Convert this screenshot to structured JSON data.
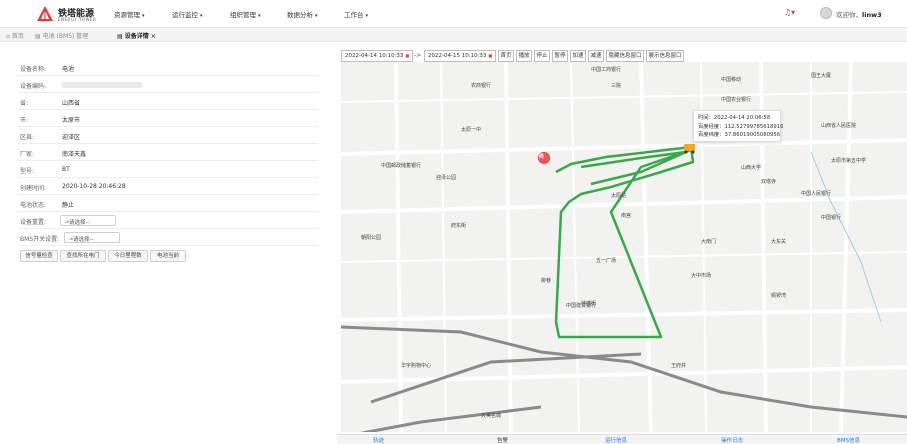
{
  "header": {
    "brand": "铁塔能源",
    "brand_sub": "ENERGY TOWER",
    "nav": [
      "资源管理",
      "运行监控",
      "组织管理",
      "数据分析",
      "工作台"
    ],
    "welcome": "欢迎你，",
    "username": "linw3"
  },
  "tabs": [
    {
      "label": "首页"
    },
    {
      "label": "电池 (BMS) 管理"
    },
    {
      "label": "设备详情"
    }
  ],
  "device": {
    "fields": [
      {
        "label": "设备名称:",
        "value": "电池"
      },
      {
        "label": "设备编码:",
        "value": ""
      },
      {
        "label": "省:",
        "value": "山西省"
      },
      {
        "label": "市:",
        "value": "太原市"
      },
      {
        "label": "区县:",
        "value": "迎泽区"
      },
      {
        "label": "厂家:",
        "value": "南泽天鑫"
      },
      {
        "label": "型号:",
        "value": "BT"
      },
      {
        "label": "创建时间:",
        "value": "2020-10-28 20:46:28"
      },
      {
        "label": "电池状态:",
        "value": "静止"
      }
    ],
    "selects": [
      {
        "label": "设备重置:",
        "value": "--请选择--"
      },
      {
        "label": "BMS开关设置:",
        "value": "--请选择--"
      }
    ],
    "buttons": [
      "信号量检查",
      "查找所在电门",
      "今日里程数",
      "电池当前"
    ]
  },
  "map_controls": {
    "start": "2022-04-14 10:10:33",
    "end": "2022-04-15 10:10:33",
    "arrow": "->",
    "buttons": [
      "首页",
      "播放",
      "停止",
      "暂停",
      "加速",
      "减速",
      "隐藏信息窗口",
      "展示信息窗口"
    ]
  },
  "info_window": {
    "time": "时间：2022-04-14 20:06:58",
    "lng": "百度经度：112.52799785618916",
    "lat": "百度纬度：37.86019005080956"
  },
  "pois": [
    {
      "name": "农商银行"
    },
    {
      "name": "中国工商银行"
    },
    {
      "name": "三院"
    },
    {
      "name": "中国移动"
    },
    {
      "name": "国王大厦"
    },
    {
      "name": "太原一中"
    },
    {
      "name": "中国农业银行"
    },
    {
      "name": "中国邮政储蓄银行"
    },
    {
      "name": "迎泽公园"
    },
    {
      "name": "山西大学"
    },
    {
      "name": "双塔寺"
    },
    {
      "name": "太原站"
    },
    {
      "name": "朝阳公园"
    },
    {
      "name": "中国银行"
    },
    {
      "name": "大南门"
    },
    {
      "name": "大东关"
    },
    {
      "name": "府东街"
    },
    {
      "name": "中国人民银行"
    },
    {
      "name": "山西省人民医院"
    },
    {
      "name": "太原市第五中学"
    },
    {
      "name": "南宫"
    },
    {
      "name": "五一广场"
    },
    {
      "name": "柳巷"
    },
    {
      "name": "钟楼街"
    },
    {
      "name": "大中市场"
    },
    {
      "name": "铜锣湾"
    },
    {
      "name": "华宇购物中心"
    },
    {
      "name": "王府井"
    },
    {
      "name": "天美名城"
    },
    {
      "name": "中国建设银行"
    }
  ],
  "marker": {
    "label": "终"
  },
  "bottom_tabs": [
    "轨迹",
    "告警",
    "运行信息",
    "操作日志",
    "BMS信息"
  ],
  "colors": {
    "track": "#3aa84a",
    "accent": "#1e78ff",
    "brand_red": "#e23b3b"
  }
}
